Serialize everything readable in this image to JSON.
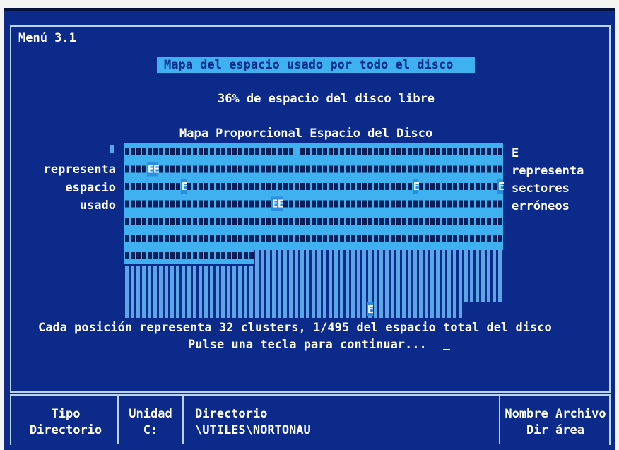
{
  "menu_label": "Menú 3.1",
  "title": "Mapa del espacio usado por todo el disco",
  "free_space": "36% de espacio del disco libre",
  "map_title": "Mapa Proporcional Espacio del Disco",
  "left_legend": [
    "representa",
    "espacio",
    "usado"
  ],
  "right_legend": [
    "representa",
    "sectores",
    "erróneos"
  ],
  "error_marker": "E",
  "footnote": "Cada posición representa 32 clusters, 1/495 del espacio total del disco",
  "continue_prompt": "Pulse una tecla para continuar...",
  "status_bar": {
    "tipo_label": "Tipo",
    "tipo_value": "Directorio",
    "unidad_label": "Unidad",
    "unidad_value": "C:",
    "directorio_label": "Directorio",
    "directorio_value": "\\UTILES\\NORTONAU",
    "archivo_label": "Nombre Archivo",
    "archivo_value": "Dir área"
  },
  "colors": {
    "screen_bg": "#0b2a8a",
    "map_bg": "#3fb0f0",
    "used_block": "#0a1e5c",
    "free_block": "#5aa6e6",
    "text": "#ffffff"
  }
}
